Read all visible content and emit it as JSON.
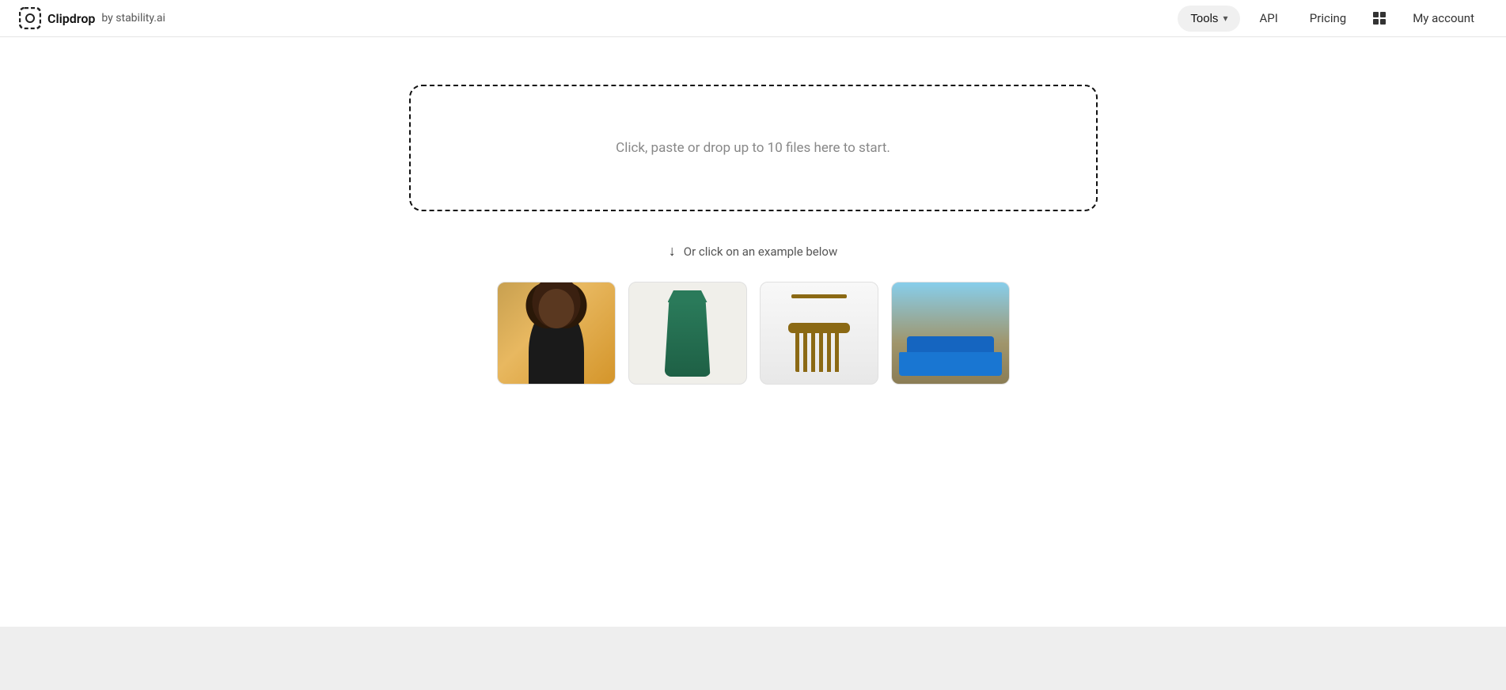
{
  "brand": {
    "name": "Clipdrop",
    "subtitle": "by stability.ai",
    "logo_alt": "clipdrop-logo"
  },
  "navbar": {
    "tools_label": "Tools",
    "api_label": "API",
    "pricing_label": "Pricing",
    "my_account_label": "My account"
  },
  "dropzone": {
    "text": "Click, paste or drop up to 10 files here to start."
  },
  "examples": {
    "label": "Or click on an example below",
    "images": [
      {
        "alt": "person-example",
        "type": "person"
      },
      {
        "alt": "dress-example",
        "type": "dress"
      },
      {
        "alt": "chair-example",
        "type": "chair"
      },
      {
        "alt": "car-example",
        "type": "car"
      }
    ]
  }
}
